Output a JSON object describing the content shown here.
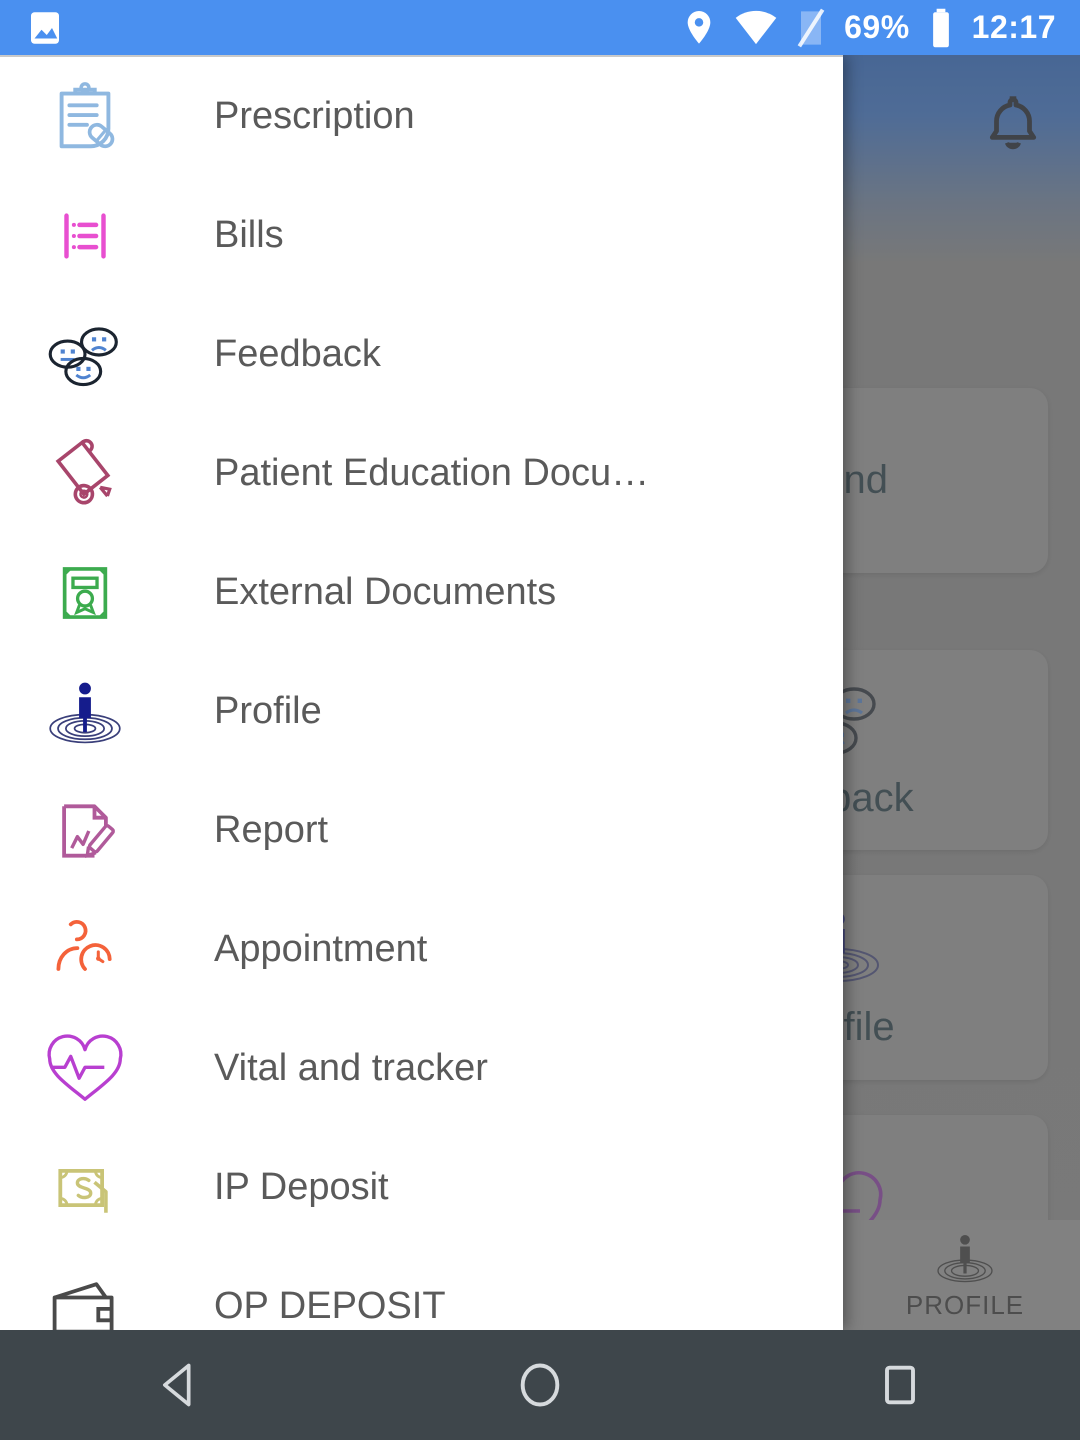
{
  "status_bar": {
    "left_icon": "image-icon",
    "icons": [
      "location-icon",
      "wifi-icon",
      "signal-icon"
    ],
    "battery_percent": "69%",
    "time": "12:17",
    "background_color": "#4a90f0"
  },
  "drawer": {
    "items": [
      {
        "label": "Prescription",
        "icon": "prescription-icon",
        "color": "#8fb8e0"
      },
      {
        "label": "Bills",
        "icon": "bills-list-icon",
        "color": "#e84fd0"
      },
      {
        "label": "Feedback",
        "icon": "feedback-faces-icon",
        "color": "#3a3a4a"
      },
      {
        "label": "Patient Education Docu…",
        "icon": "diploma-scroll-icon",
        "color": "#a8456b"
      },
      {
        "label": "External Documents",
        "icon": "certificate-icon",
        "color": "#3cab4e"
      },
      {
        "label": "Profile",
        "icon": "profile-person-icon",
        "color": "#151c8c"
      },
      {
        "label": "Report",
        "icon": "report-edit-icon",
        "color": "#b05a9a"
      },
      {
        "label": "Appointment",
        "icon": "appointment-clock-icon",
        "color": "#f4623a"
      },
      {
        "label": "Vital and tracker",
        "icon": "heart-pulse-icon",
        "color": "#b83fd0"
      },
      {
        "label": "IP Deposit",
        "icon": "money-note-icon",
        "color": "#c9c477"
      },
      {
        "label": "OP DEPOSIT",
        "icon": "wallet-icon",
        "color": "#4a4a4a"
      }
    ]
  },
  "background_app": {
    "bell_icon": "notification-bell-icon",
    "cards": [
      {
        "label": "efund",
        "icon": ""
      },
      {
        "label": "eedback",
        "icon": "feedback-faces-icon"
      },
      {
        "label": "Profile",
        "icon": "profile-person-icon"
      },
      {
        "label": "",
        "icon": "heart-pulse-icon"
      }
    ],
    "bottom_nav": [
      {
        "label": "PROFILE",
        "icon": "profile-person-icon"
      }
    ]
  },
  "android_nav": {
    "back": "back-triangle-icon",
    "home": "home-circle-icon",
    "recents": "recents-square-icon"
  }
}
